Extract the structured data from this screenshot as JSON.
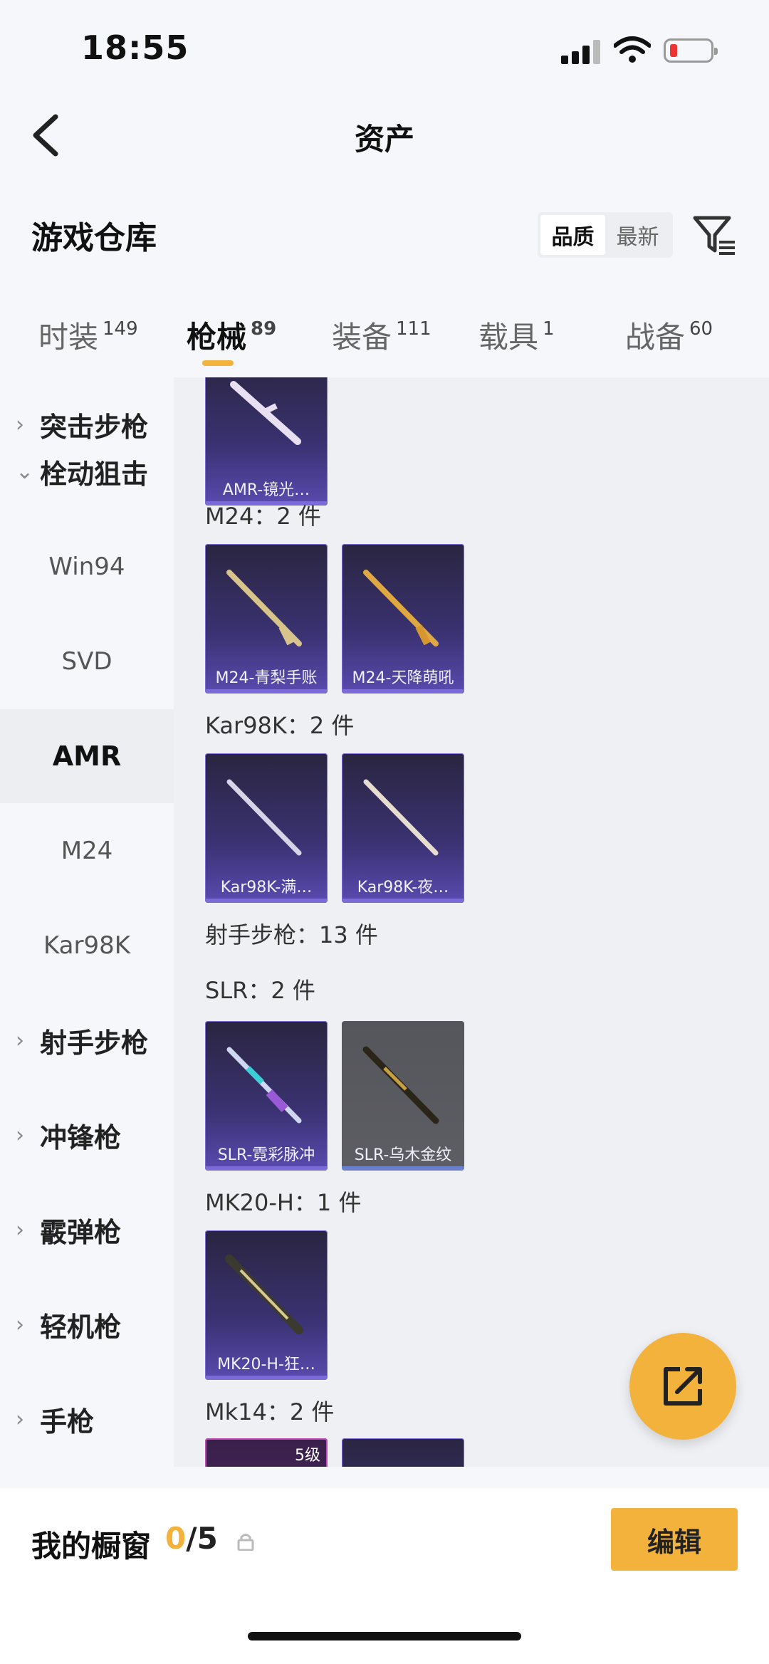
{
  "status": {
    "time": "18:55"
  },
  "nav": {
    "title": "资产"
  },
  "section": {
    "title": "游戏仓库",
    "sort_options": [
      "品质",
      "最新"
    ]
  },
  "tabs": [
    {
      "label": "时装",
      "count": "149"
    },
    {
      "label": "枪械",
      "count": "89"
    },
    {
      "label": "装备",
      "count": "111"
    },
    {
      "label": "载具",
      "count": "1"
    },
    {
      "label": "战备",
      "count": "60"
    }
  ],
  "sidebar": [
    {
      "label": "突击步枪",
      "type": "cat",
      "chev": "›"
    },
    {
      "label": "栓动狙击",
      "type": "cat",
      "chev": "⌄"
    },
    {
      "label": "Win94",
      "type": "sub"
    },
    {
      "label": "SVD",
      "type": "sub"
    },
    {
      "label": "AMR",
      "type": "sub",
      "selected": true
    },
    {
      "label": "M24",
      "type": "sub"
    },
    {
      "label": "Kar98K",
      "type": "sub"
    },
    {
      "label": "射手步枪",
      "type": "cat",
      "chev": "›"
    },
    {
      "label": "冲锋枪",
      "type": "cat",
      "chev": "›"
    },
    {
      "label": "霰弹枪",
      "type": "cat",
      "chev": "›"
    },
    {
      "label": "轻机枪",
      "type": "cat",
      "chev": "›"
    },
    {
      "label": "手枪",
      "type": "cat",
      "chev": "›"
    }
  ],
  "content": {
    "groups": [
      {
        "label": "M24：2 件"
      },
      {
        "label": "Kar98K：2 件"
      },
      {
        "label": "射手步枪：13 件"
      },
      {
        "label": "SLR：2 件"
      },
      {
        "label": "MK20-H：1 件"
      },
      {
        "label": "Mk14：2 件"
      }
    ],
    "cards": [
      {
        "name": "AMR-镜光…"
      },
      {
        "name": "M24-青梨手账"
      },
      {
        "name": "M24-天降萌吼"
      },
      {
        "name": "Kar98K-满…"
      },
      {
        "name": "Kar98K-夜…"
      },
      {
        "name": "SLR-霓彩脉冲"
      },
      {
        "name": "SLR-乌木金纹"
      },
      {
        "name": "MK20-H-狂…"
      },
      {
        "name": "",
        "level": "5级"
      },
      {
        "name": ""
      }
    ]
  },
  "bottom": {
    "showcase_label": "我的橱窗",
    "count_current": "0",
    "count_total": "/5",
    "edit_label": "编辑"
  },
  "colors": {
    "accent": "#f2b23b",
    "card_purple": "#3a3272",
    "card_border": "#7b6ad8"
  }
}
